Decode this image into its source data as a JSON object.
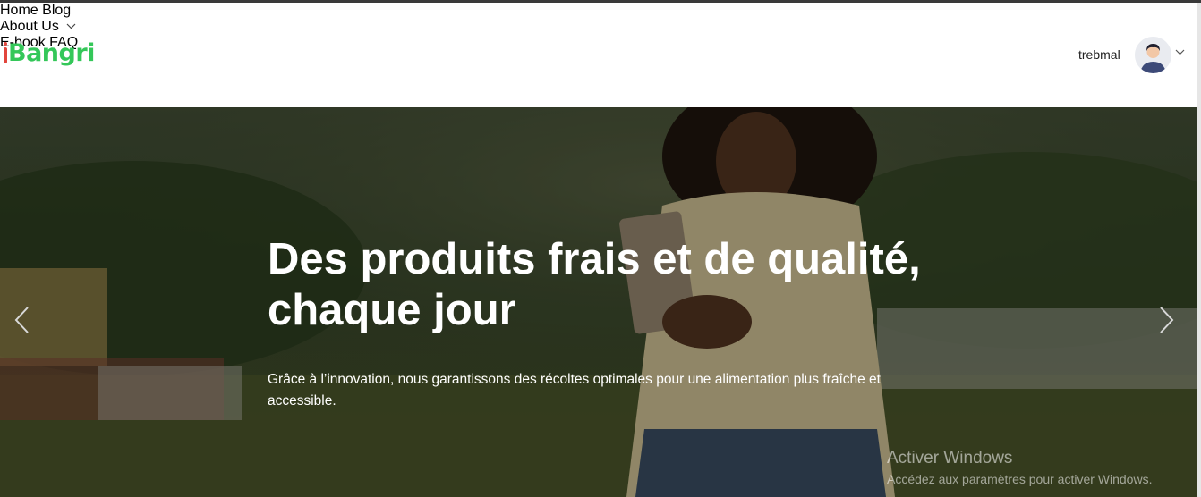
{
  "brand": {
    "logo_text": "Bangri",
    "logo_color": "#34c759",
    "logo_accent": "#e2453c"
  },
  "nav": {
    "items": [
      {
        "label": "Home",
        "has_dropdown": false
      },
      {
        "label": "Blog",
        "has_dropdown": false
      },
      {
        "label": "About Us",
        "has_dropdown": true
      },
      {
        "label": "E-book",
        "has_dropdown": false
      },
      {
        "label": "FAQ",
        "has_dropdown": false
      }
    ],
    "username": "trebmal",
    "avatar_icon": "user-avatar-icon"
  },
  "hero": {
    "title": "Des produits frais et de qualité, chaque jour",
    "subtitle": "Grâce à l’innovation, nous garantissons des récoltes optimales pour une alimentation plus fraîche et accessible.",
    "prev_icon": "chevron-left-icon",
    "next_icon": "chevron-right-icon"
  },
  "watermark": {
    "line1": "Activer Windows",
    "line2": "Accédez aux paramètres pour activer Windows."
  }
}
